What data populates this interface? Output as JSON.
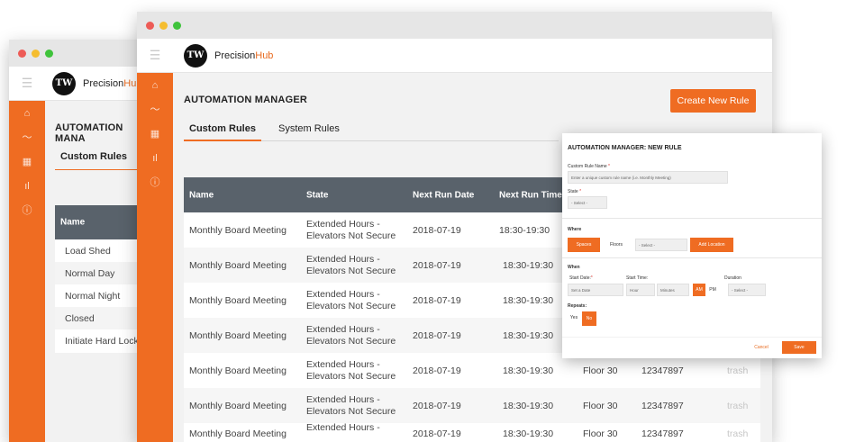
{
  "colors": {
    "accent": "#ef6c22",
    "header": "#59626b"
  },
  "brand": {
    "prefix": "Precision",
    "suffix": "Hub",
    "logo": "TW"
  },
  "sidebar_icons": [
    "home-icon",
    "activity-icon",
    "grid-icon",
    "bar-chart-icon",
    "info-icon"
  ],
  "back": {
    "title": "AUTOMATION MANA",
    "tab_active": "Custom Rules",
    "column_name": "Name",
    "items": [
      "Load Shed",
      "Normal Day",
      "Normal Night",
      "Closed",
      "Initiate Hard Lock"
    ]
  },
  "front": {
    "title": "AUTOMATION MANAGER",
    "create_button": "Create New Rule",
    "tabs": [
      "Custom Rules",
      "System Rules"
    ],
    "columns": [
      "Name",
      "State",
      "Next Run Date",
      "Next Run Time"
    ],
    "rows": [
      {
        "name": "Monthly Board Meeting",
        "state1": "Extended Hours -",
        "state2": "Elevators Not Secure",
        "date": "2018-07-19",
        "time": "18:30-19:30",
        "floor": "",
        "id": "",
        "action": ""
      },
      {
        "name": "Monthly Board Meeting",
        "state1": "Extended Hours -",
        "state2": "Elevators Not Secure",
        "date": "2018-07-19",
        "time": "18:30-19:30",
        "floor": "",
        "id": "",
        "action": ""
      },
      {
        "name": "Monthly Board Meeting",
        "state1": "Extended Hours -",
        "state2": "Elevators Not Secure",
        "date": "2018-07-19",
        "time": "18:30-19:30",
        "floor": "",
        "id": "",
        "action": ""
      },
      {
        "name": "Monthly Board Meeting",
        "state1": "Extended Hours -",
        "state2": "Elevators Not Secure",
        "date": "2018-07-19",
        "time": "18:30-19:30",
        "floor": "",
        "id": "",
        "action": ""
      },
      {
        "name": "Monthly Board Meeting",
        "state1": "Extended Hours -",
        "state2": "Elevators Not Secure",
        "date": "2018-07-19",
        "time": "18:30-19:30",
        "floor": "Floor 30",
        "id": "12347897",
        "action": "trash"
      },
      {
        "name": "Monthly Board Meeting",
        "state1": "Extended Hours -",
        "state2": "Elevators Not Secure",
        "date": "2018-07-19",
        "time": "18:30-19:30",
        "floor": "Floor 30",
        "id": "12347897",
        "action": "trash"
      },
      {
        "name": "Monthly Board Meeting",
        "state1": "Extended Hours -",
        "state2": "",
        "date": "2018-07-19",
        "time": "18:30-19:30",
        "floor": "Floor 30",
        "id": "12347897",
        "action": "trash"
      }
    ]
  },
  "modal": {
    "title": "AUTOMATION MANAGER: NEW RULE",
    "name_label": "Custom Rule Name",
    "name_placeholder": "Enter a unique custom rule name (i.e. Monthly Meeting)",
    "state_label": "State",
    "state_select": "- Select -",
    "where_label": "Where",
    "spaces": "Spaces",
    "floors": "Floors",
    "where_select": "- Select -",
    "add_location": "Add Location",
    "when_label": "When",
    "start_date_label": "Start Date:",
    "start_date_placeholder": "Set a Date",
    "start_time_label": "Start Time:",
    "hour": "Hour",
    "minutes": "Minutes",
    "am": "AM",
    "pm": "PM",
    "duration_label": "Duration",
    "duration_select": "- Select -",
    "repeats_label": "Repeats:",
    "yes": "Yes",
    "no": "No",
    "cancel": "Cancel",
    "save": "Save",
    "required_mark": "*"
  }
}
